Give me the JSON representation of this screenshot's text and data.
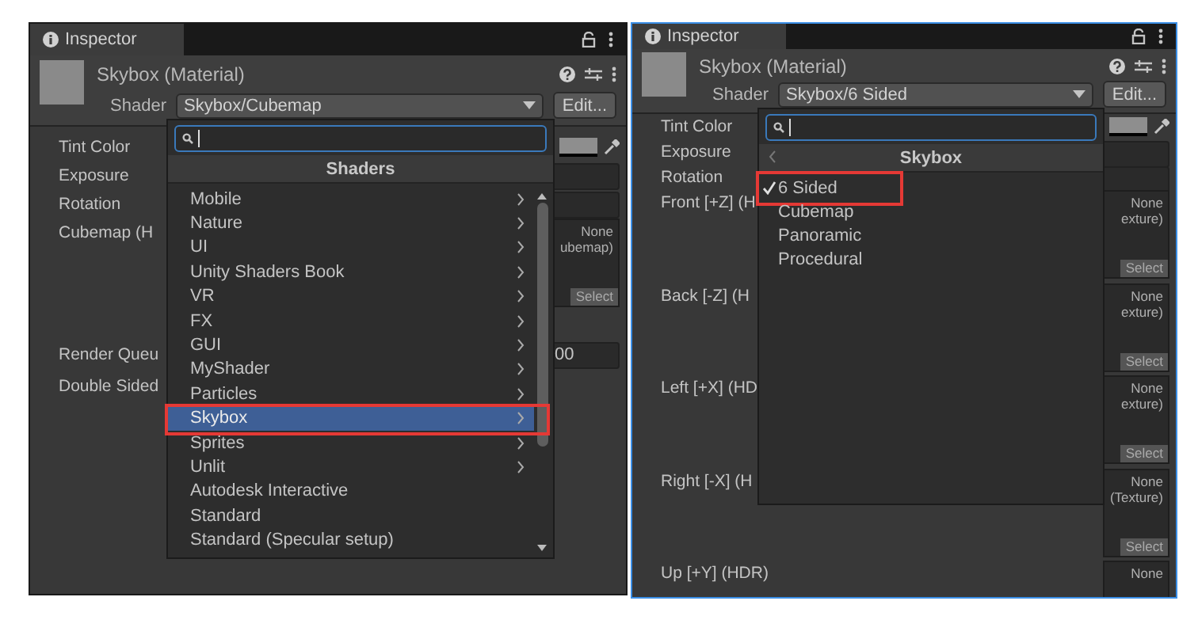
{
  "panels": [
    {
      "focused": false,
      "tab": "Inspector",
      "material": "Skybox (Material)",
      "shader_label": "Shader",
      "shader_value": "Skybox/Cubemap",
      "edit_button": "Edit...",
      "properties": [
        {
          "kind": "color",
          "label": "Tint Color"
        },
        {
          "kind": "field",
          "label": "Exposure"
        },
        {
          "kind": "field",
          "label": "Rotation"
        },
        {
          "kind": "texture",
          "label": "Cubemap (H",
          "slot_text": [
            "None",
            "ubemap)"
          ],
          "select": "Select"
        },
        {
          "kind": "field",
          "label": "Render Queu",
          "value": "00"
        },
        {
          "kind": "plain",
          "label": "Double Sided"
        }
      ],
      "popup": {
        "header": "Shaders",
        "back": false,
        "scrollbar": true,
        "items": [
          {
            "label": "Mobile",
            "submenu": true,
            "selected": false,
            "checked": false,
            "annotated": false
          },
          {
            "label": "Nature",
            "submenu": true,
            "selected": false,
            "checked": false,
            "annotated": false
          },
          {
            "label": "UI",
            "submenu": true,
            "selected": false,
            "checked": false,
            "annotated": false
          },
          {
            "label": "Unity Shaders Book",
            "submenu": true,
            "selected": false,
            "checked": false,
            "annotated": false
          },
          {
            "label": "VR",
            "submenu": true,
            "selected": false,
            "checked": false,
            "annotated": false
          },
          {
            "label": "FX",
            "submenu": true,
            "selected": false,
            "checked": false,
            "annotated": false
          },
          {
            "label": "GUI",
            "submenu": true,
            "selected": false,
            "checked": false,
            "annotated": false
          },
          {
            "label": "MyShader",
            "submenu": true,
            "selected": false,
            "checked": false,
            "annotated": false
          },
          {
            "label": "Particles",
            "submenu": true,
            "selected": false,
            "checked": false,
            "annotated": false
          },
          {
            "label": "Skybox",
            "submenu": true,
            "selected": true,
            "checked": false,
            "annotated": true
          },
          {
            "label": "Sprites",
            "submenu": true,
            "selected": false,
            "checked": false,
            "annotated": false
          },
          {
            "label": "Unlit",
            "submenu": true,
            "selected": false,
            "checked": false,
            "annotated": false
          },
          {
            "label": "Autodesk Interactive",
            "submenu": false,
            "selected": false,
            "checked": false,
            "annotated": false
          },
          {
            "label": "Standard",
            "submenu": false,
            "selected": false,
            "checked": false,
            "annotated": false
          },
          {
            "label": "Standard (Specular setup)",
            "submenu": false,
            "selected": false,
            "checked": false,
            "annotated": false
          }
        ]
      }
    },
    {
      "focused": true,
      "tab": "Inspector",
      "material": "Skybox (Material)",
      "shader_label": "Shader",
      "shader_value": "Skybox/6 Sided",
      "edit_button": "Edit...",
      "properties": [
        {
          "kind": "color",
          "label": "Tint Color"
        },
        {
          "kind": "field",
          "label": "Exposure"
        },
        {
          "kind": "field",
          "label": "Rotation"
        },
        {
          "kind": "texture",
          "label": "Front [+Z] (H",
          "slot_text": [
            "None",
            "exture)"
          ],
          "select": "Select"
        },
        {
          "kind": "texture",
          "label": "Back [-Z] (H",
          "slot_text": [
            "None",
            "exture)"
          ],
          "select": "Select"
        },
        {
          "kind": "texture",
          "label": "Left [+X] (HD",
          "slot_text": [
            "None",
            "exture)"
          ],
          "select": "Select"
        },
        {
          "kind": "texture",
          "label": "Right [-X] (H",
          "slot_text": [
            "None",
            "(Texture)"
          ],
          "select": "Select"
        },
        {
          "kind": "texture",
          "label": "Up [+Y] (HDR)",
          "slot_text": [
            "None"
          ]
        }
      ],
      "popup": {
        "header": "Skybox",
        "back": true,
        "scrollbar": false,
        "items": [
          {
            "label": "6 Sided",
            "submenu": false,
            "selected": false,
            "checked": true,
            "annotated": true
          },
          {
            "label": "Cubemap",
            "submenu": false,
            "selected": false,
            "checked": false,
            "annotated": false
          },
          {
            "label": "Panoramic",
            "submenu": false,
            "selected": false,
            "checked": false,
            "annotated": false
          },
          {
            "label": "Procedural",
            "submenu": false,
            "selected": false,
            "checked": false,
            "annotated": false
          }
        ]
      }
    }
  ]
}
